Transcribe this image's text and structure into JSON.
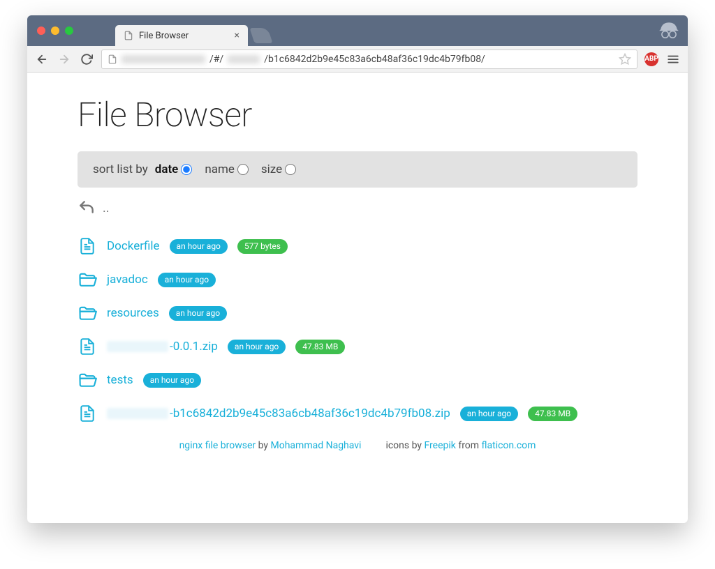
{
  "chrome": {
    "tab_title": "File Browser",
    "url_prefix_redacted": "—————",
    "url_mid": "/#/",
    "url_mid_redacted": "——",
    "url_path": "/b1c6842d2b9e45c83a6cb48af36c19dc4b79fb08/",
    "abp_label": "ABP"
  },
  "page": {
    "title": "File Browser"
  },
  "sort": {
    "label": "sort list by",
    "options": [
      {
        "key": "date",
        "label": "date",
        "selected": true
      },
      {
        "key": "name",
        "label": "name",
        "selected": false
      },
      {
        "key": "size",
        "label": "size",
        "selected": false
      }
    ]
  },
  "parent": {
    "label": ".."
  },
  "files": [
    {
      "type": "file",
      "name_prefix_redacted": false,
      "name": "Dockerfile",
      "time": "an hour ago",
      "size": "577 bytes"
    },
    {
      "type": "folder",
      "name_prefix_redacted": false,
      "name": "javadoc",
      "time": "an hour ago",
      "size": null
    },
    {
      "type": "folder",
      "name_prefix_redacted": false,
      "name": "resources",
      "time": "an hour ago",
      "size": null
    },
    {
      "type": "file",
      "name_prefix_redacted": true,
      "name": "-0.0.1.zip",
      "prefix_width": 88,
      "time": "an hour ago",
      "size": "47.83 MB"
    },
    {
      "type": "folder",
      "name_prefix_redacted": false,
      "name": "tests",
      "time": "an hour ago",
      "size": null
    },
    {
      "type": "file",
      "name_prefix_redacted": true,
      "name": "-b1c6842d2b9e45c83a6cb48af36c19dc4b79fb08.zip",
      "prefix_width": 88,
      "time": "an hour ago",
      "size": "47.83 MB"
    }
  ],
  "footer": {
    "app_link": "nginx file browser",
    "by": " by ",
    "author_link": "Mohammad Naghavi",
    "icons_by": "icons by ",
    "icon_author_link": "Freepik",
    "from": " from ",
    "icon_site_link": "flaticon.com"
  }
}
